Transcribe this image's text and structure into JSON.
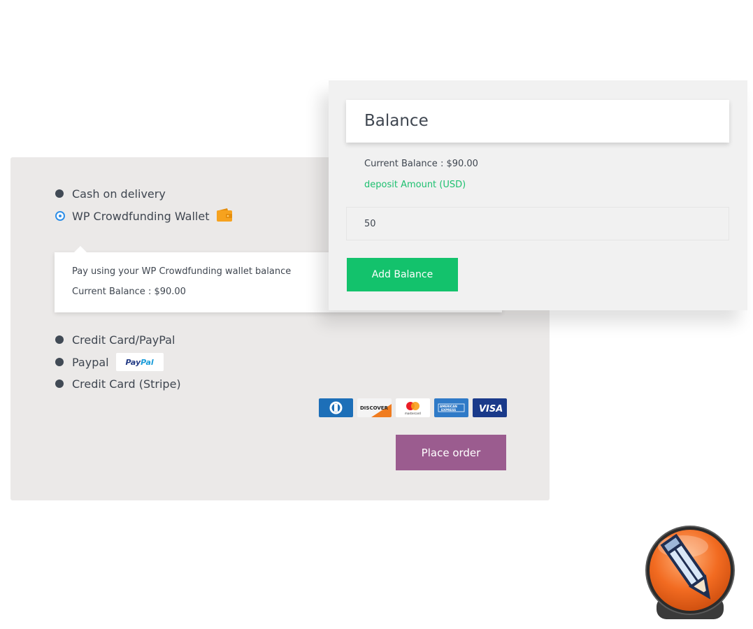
{
  "checkout": {
    "methods": [
      {
        "label": "Cash on delivery",
        "selected": false
      },
      {
        "label": "WP Crowdfunding Wallet",
        "selected": true,
        "icon": "wallet-icon"
      },
      {
        "label": "Credit Card/PayPal",
        "selected": false
      },
      {
        "label": "Paypal",
        "selected": false,
        "badge": "PayPal"
      },
      {
        "label": "Credit Card (Stripe)",
        "selected": false
      }
    ],
    "wallet_tooltip": {
      "line1": "Pay using your WP Crowdfunding wallet balance",
      "line2": "Current Balance : $90.00"
    },
    "paypal_badge": {
      "part1": "Pay",
      "part2": "Pal"
    },
    "card_logos": [
      {
        "name": "diners-club-icon"
      },
      {
        "name": "discover-icon",
        "text": "DISCOVER"
      },
      {
        "name": "mastercard-icon",
        "text": "mastercard"
      },
      {
        "name": "amex-icon",
        "text": "AMERICAN EXPRESS"
      },
      {
        "name": "visa-icon",
        "text": "VISA"
      }
    ],
    "place_order_label": "Place order",
    "colors": {
      "place_order": "#9b5c8f",
      "panel_bg": "#ebe9e8",
      "radio_selected": "#2f8fe8"
    }
  },
  "balance": {
    "title": "Balance",
    "current_balance": "Current Balance : $90.00",
    "deposit_label": "deposit Amount (USD)",
    "amount_value": "50",
    "add_button_label": "Add Balance",
    "colors": {
      "add_button": "#13c26c",
      "deposit_label": "#1ec070"
    }
  },
  "app_icon": {
    "name": "pencil-app-icon",
    "color": "#f26b21"
  }
}
